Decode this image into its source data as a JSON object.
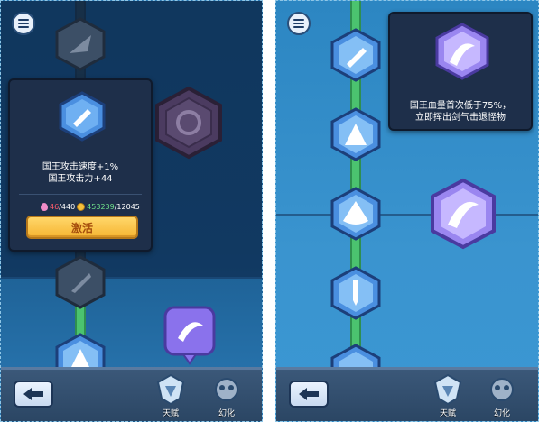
{
  "left_panel": {
    "popup": {
      "line1": "国王攻击速度+1%",
      "line2": "国王攻击力+44",
      "gem_have": "46",
      "gem_sep": "/",
      "gem_need": "440",
      "coin_have": "453239",
      "coin_sep": "/",
      "coin_need": "12045",
      "activate_label": "激活"
    }
  },
  "right_panel": {
    "popup": {
      "line1": "国王血量首次低于75%，",
      "line2": "立即挥出剑气击退怪物"
    }
  },
  "bottom_bar": {
    "tab_talent_label": "天赋",
    "tab_transform_label": "幻化"
  },
  "icons": {
    "menu": "menu-icon",
    "back": "back-arrow-icon",
    "talent": "talent-emblem-icon",
    "transform": "transform-mask-icon",
    "gem": "gem-icon",
    "coin": "coin-icon"
  },
  "colors": {
    "track_active": "#4bc36f",
    "node_blue": "#4a8fe0",
    "node_purple": "#7b6be0",
    "activate_button": "#f6b532",
    "cost_red": "#ff5b6b",
    "cost_green": "#6fe08a"
  }
}
